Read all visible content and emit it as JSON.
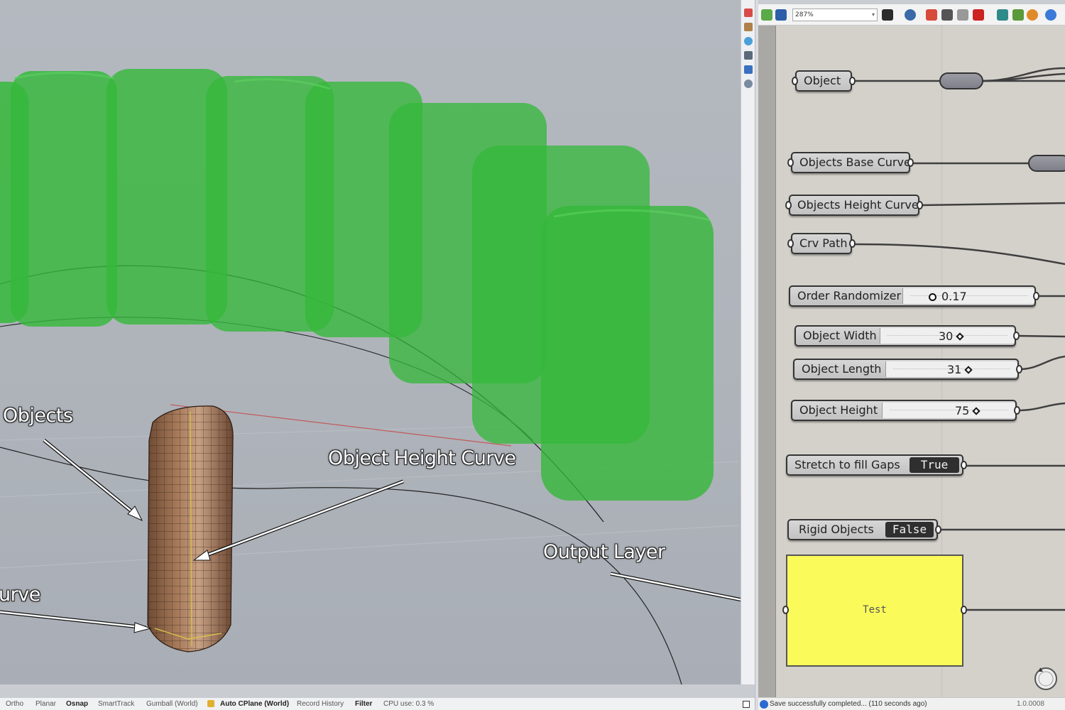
{
  "viewport": {
    "annotations": {
      "objects": "Objects",
      "object_height_curve": "Object Height Curve",
      "output_layer": "Output Layer",
      "curve_partial": "urve"
    }
  },
  "grasshopper": {
    "toolbar": {
      "zoom": "287%"
    },
    "nodes": {
      "object": {
        "label": "Object"
      },
      "objects_base_curve": {
        "label": "Objects Base Curve"
      },
      "objects_height_curve": {
        "label": "Objects Height Curve"
      },
      "crv_path": {
        "label": "Crv Path"
      },
      "order_randomizer": {
        "label": "Order Randomizer",
        "value": "0.17"
      },
      "object_width": {
        "label": "Object Width",
        "value": "30"
      },
      "object_length": {
        "label": "Object Length",
        "value": "31"
      },
      "object_height": {
        "label": "Object Height",
        "value": "75"
      },
      "stretch_to_fill_gaps": {
        "label": "Stretch to fill Gaps",
        "value": "True"
      },
      "rigid_objects": {
        "label": "Rigid Objects",
        "value": "False"
      },
      "panel": {
        "text": "Test"
      }
    },
    "status": {
      "message": "Save successfully completed... (110 seconds ago)",
      "version": "1.0.0008"
    }
  },
  "rhino_status": {
    "ortho": "Ortho",
    "planar": "Planar",
    "osnap": "Osnap",
    "smarttrack": "SmartTrack",
    "gumball": "Gumball (World)",
    "auto_cplane": "Auto CPlane (World)",
    "record_history": "Record History",
    "filter": "Filter",
    "cpu": "CPU use: 0.3 %"
  },
  "colors": {
    "object_green": "#35b83a",
    "panel_yellow": "#fafa5a",
    "canvas": "#d4d1cb"
  }
}
